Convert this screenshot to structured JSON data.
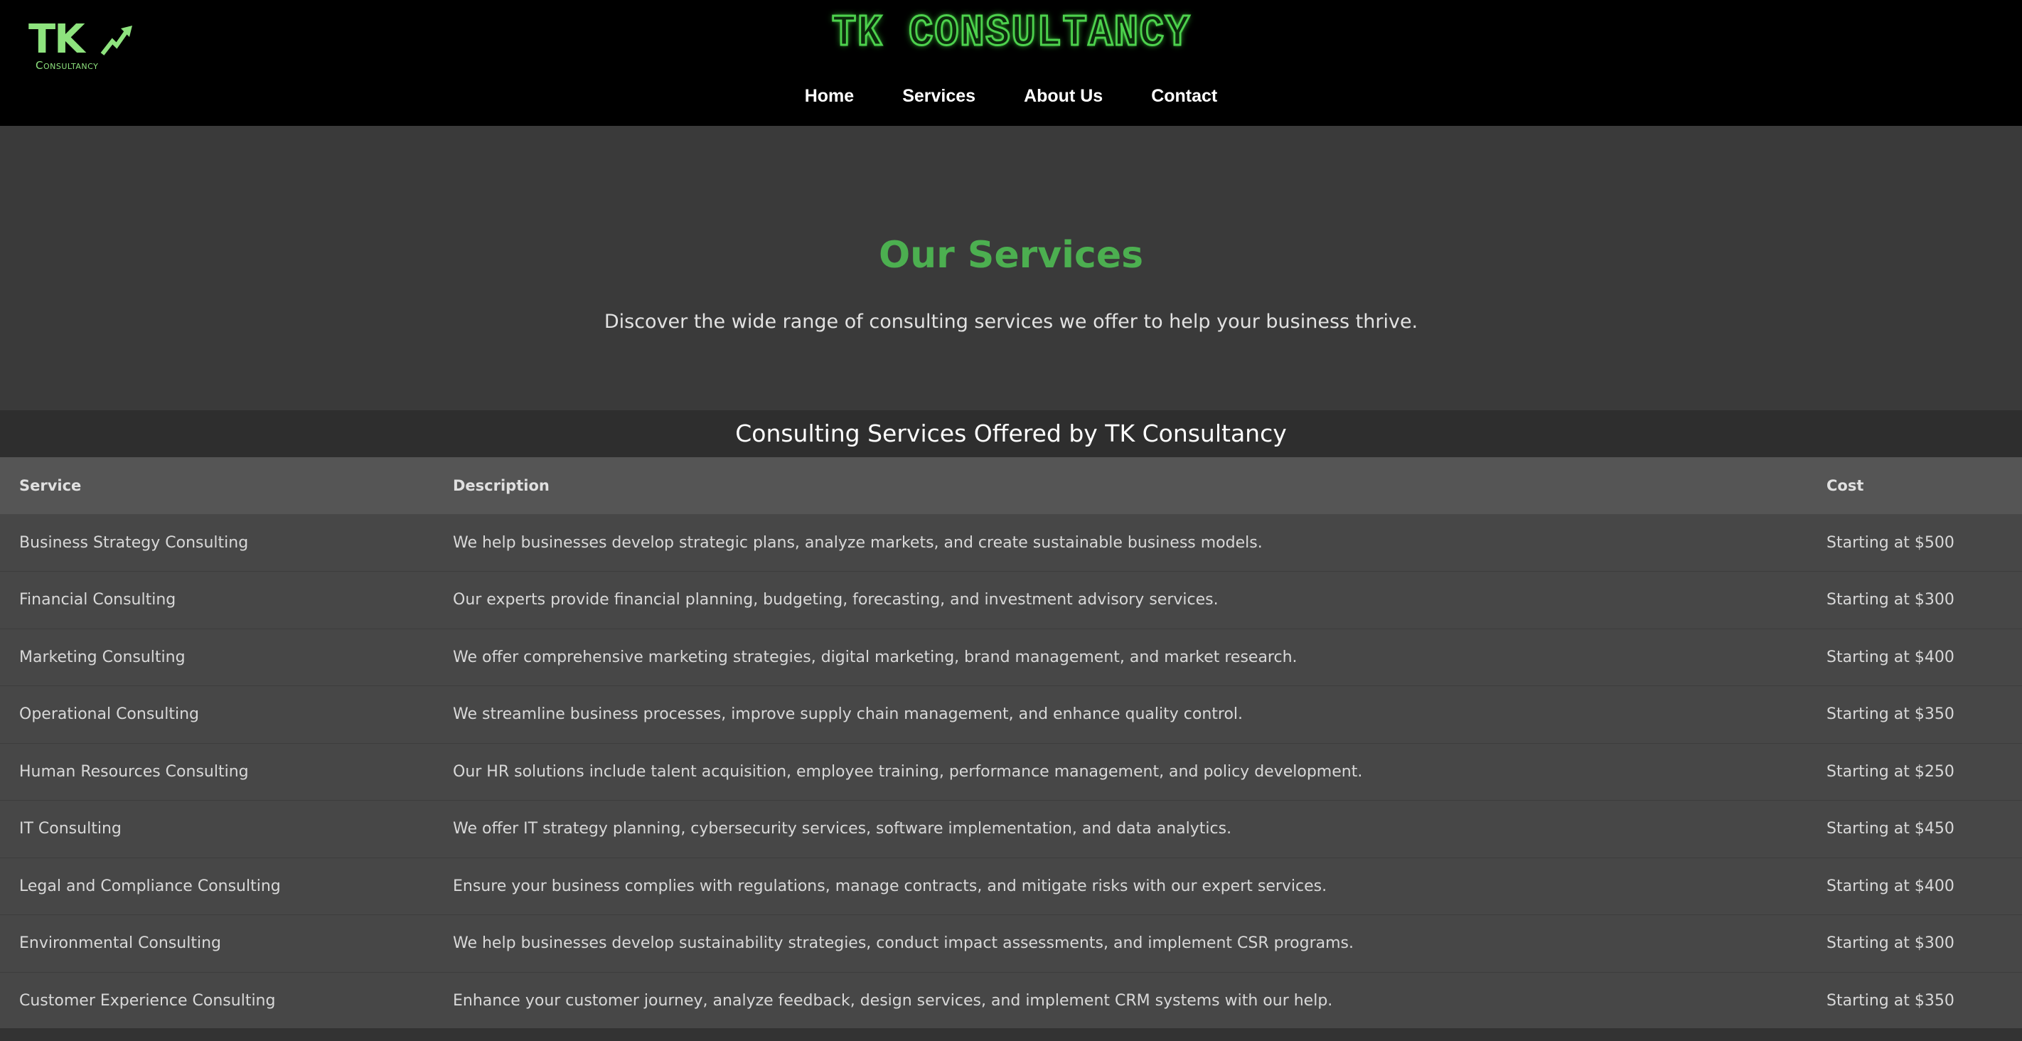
{
  "header": {
    "logo_text": "TK",
    "logo_subtext": "Consultancy",
    "brand_title": "TK CONSULTANCY",
    "nav": [
      {
        "label": "Home"
      },
      {
        "label": "Services"
      },
      {
        "label": "About Us"
      },
      {
        "label": "Contact"
      }
    ]
  },
  "hero": {
    "title": "Our Services",
    "subtitle": "Discover the wide range of consulting services we offer to help your business thrive."
  },
  "table": {
    "caption": "Consulting Services Offered by TK Consultancy",
    "headers": [
      "Service",
      "Description",
      "Cost"
    ],
    "rows": [
      {
        "service": "Business Strategy Consulting",
        "description": "We help businesses develop strategic plans, analyze markets, and create sustainable business models.",
        "cost": "Starting at $500"
      },
      {
        "service": "Financial Consulting",
        "description": "Our experts provide financial planning, budgeting, forecasting, and investment advisory services.",
        "cost": "Starting at $300"
      },
      {
        "service": "Marketing Consulting",
        "description": "We offer comprehensive marketing strategies, digital marketing, brand management, and market research.",
        "cost": "Starting at $400"
      },
      {
        "service": "Operational Consulting",
        "description": "We streamline business processes, improve supply chain management, and enhance quality control.",
        "cost": "Starting at $350"
      },
      {
        "service": "Human Resources Consulting",
        "description": "Our HR solutions include talent acquisition, employee training, performance management, and policy development.",
        "cost": "Starting at $250"
      },
      {
        "service": "IT Consulting",
        "description": "We offer IT strategy planning, cybersecurity services, software implementation, and data analytics.",
        "cost": "Starting at $450"
      },
      {
        "service": "Legal and Compliance Consulting",
        "description": "Ensure your business complies with regulations, manage contracts, and mitigate risks with our expert services.",
        "cost": "Starting at $400"
      },
      {
        "service": "Environmental Consulting",
        "description": "We help businesses develop sustainability strategies, conduct impact assessments, and implement CSR programs.",
        "cost": "Starting at $300"
      },
      {
        "service": "Customer Experience Consulting",
        "description": "Enhance your customer journey, analyze feedback, design services, and implement CRM systems with our help.",
        "cost": "Starting at $350"
      }
    ]
  },
  "colors": {
    "accent_green": "#4caf50",
    "logo_green": "#8ee37e",
    "header_bg": "#000000",
    "page_bg": "#3a3a3a"
  }
}
